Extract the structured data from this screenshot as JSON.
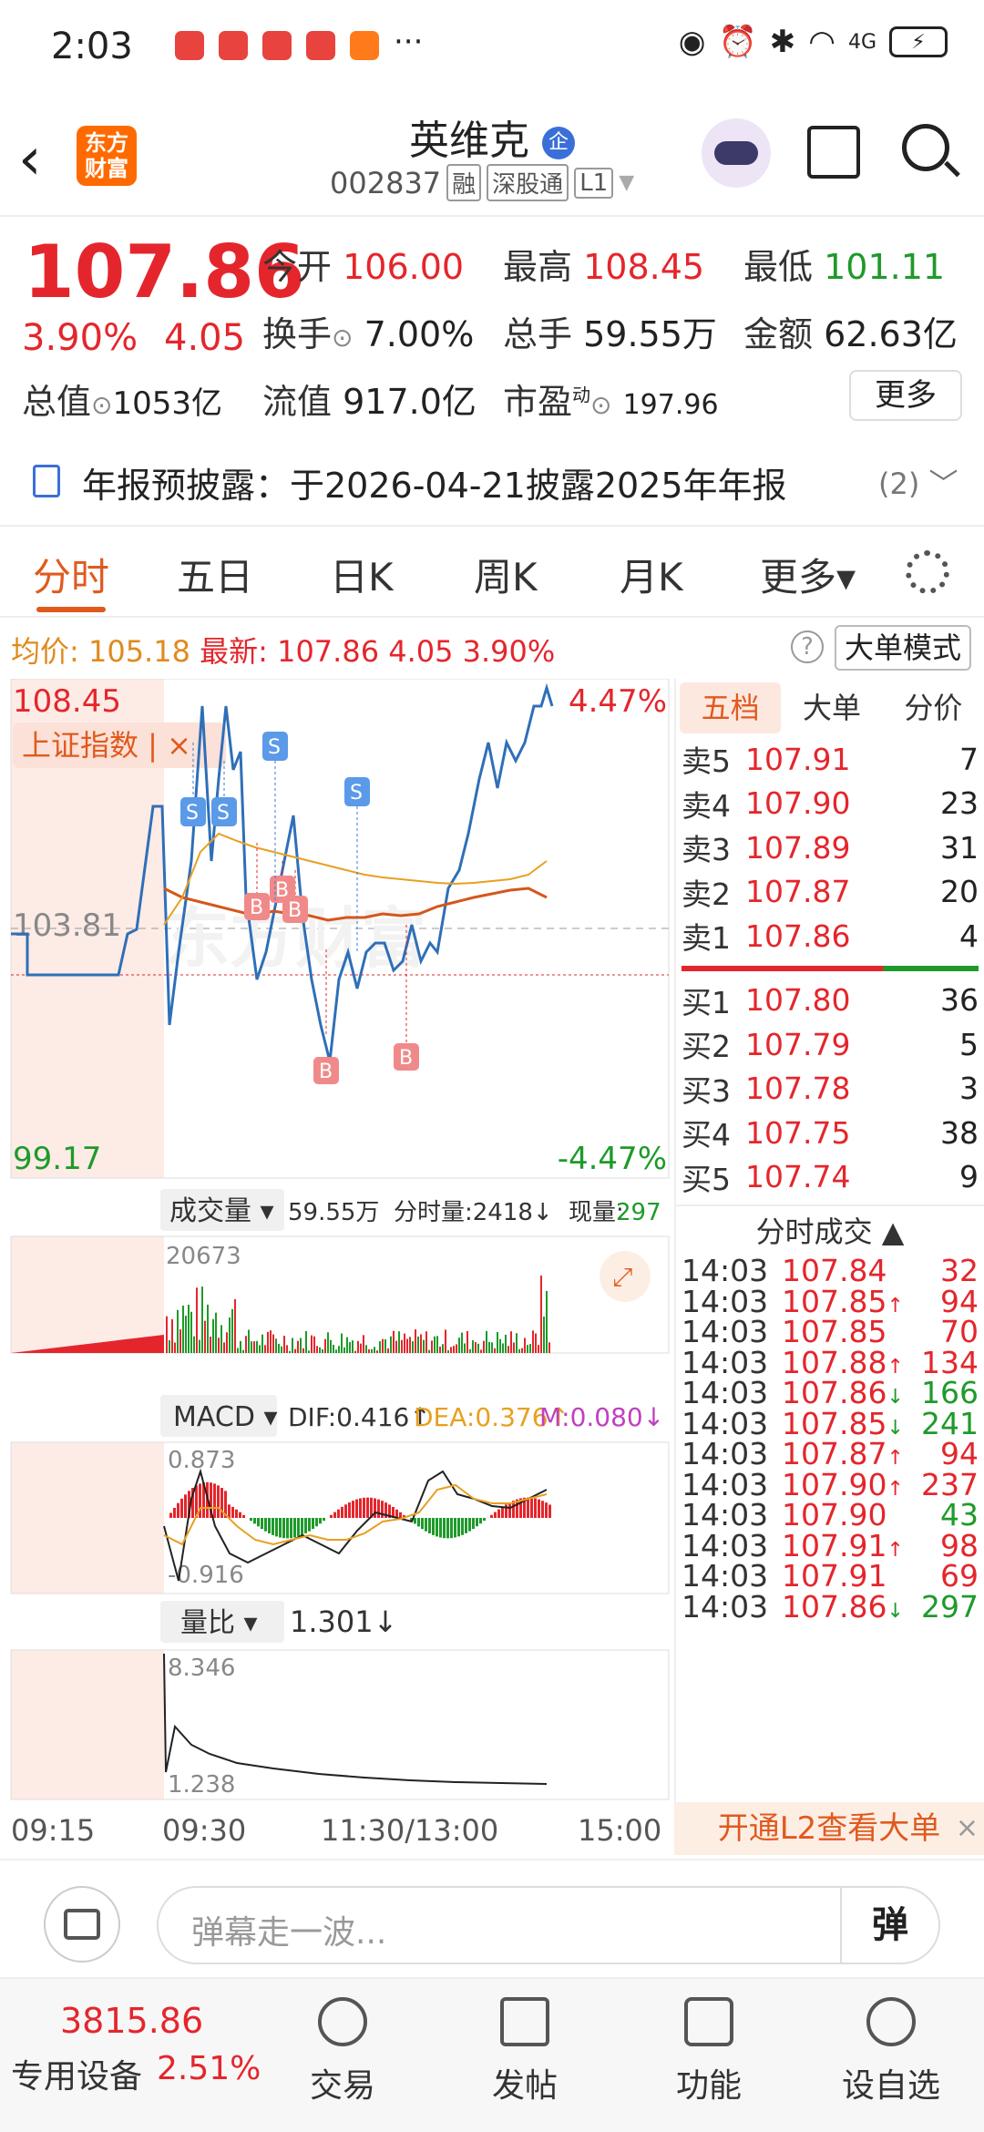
{
  "status": {
    "time": "2:03",
    "dots": "···",
    "network": "4G",
    "battery": "⚡"
  },
  "header": {
    "stock_name": "英维克",
    "qi_badge": "企",
    "code": "002837",
    "tags": [
      "融",
      "深股通",
      "L1"
    ],
    "logo_text_1": "东方",
    "logo_text_2": "财富"
  },
  "quote": {
    "price": "107.86",
    "pct": "3.90%",
    "change": "4.05",
    "open_l": "今开",
    "open": "106.00",
    "high_l": "最高",
    "high": "108.45",
    "low_l": "最低",
    "low": "101.11",
    "turnover_l": "换手",
    "turnover": "7.00%",
    "vol_l": "总手",
    "vol": "59.55万",
    "amt_l": "金额",
    "amt": "62.63亿",
    "mcap_l": "总值",
    "mcap": "1053亿",
    "float_l": "流值",
    "float": "917.0亿",
    "pe_l": "市盈",
    "pe_sup": "动",
    "pe": "197.96",
    "more": "更多"
  },
  "notice": {
    "text": "年报预披露：于2026-04-21披露2025年年报",
    "count": "(2)"
  },
  "tabs": [
    "分时",
    "五日",
    "日K",
    "周K",
    "月K",
    "更多▾"
  ],
  "avg": {
    "label": "均价:",
    "value": "105.18",
    "latest_label": "最新:",
    "latest": "107.86",
    "chg": "4.05",
    "pct": "3.90%",
    "help": "?",
    "mode": "大单模式"
  },
  "chart": {
    "top_price": "108.45",
    "top_pct": "4.47%",
    "ref": "103.81",
    "bot_price": "99.17",
    "bot_pct": "-4.47%",
    "index_tag": "上证指数 | ×",
    "vol_header": "成交量 ▾",
    "vol_total": "59.55万",
    "vol_fen": "分时量:2418↓",
    "vol_now_l": "现量:",
    "vol_now": "297",
    "vol_max": "20673",
    "macd_header": "MACD ▾",
    "dif": "DIF:0.416↑",
    "dea": "DEA:0.376↑",
    "m": "M:0.080↓",
    "macd_top": "0.873",
    "macd_bot": "-0.916",
    "lb_header": "量比 ▾",
    "lb_val": "1.301↓",
    "lb_top": "8.346",
    "lb_bot": "1.238",
    "times": [
      "09:15",
      "09:30",
      "11:30/13:00",
      "15:00"
    ],
    "watermark": "东方财富",
    "buy_marks": [
      "B",
      "B",
      "B",
      "B",
      "B"
    ],
    "sell_marks": [
      "S",
      "S",
      "S",
      "S"
    ]
  },
  "orderbook": {
    "tabs": [
      "五档",
      "大单",
      "分价"
    ],
    "asks": [
      {
        "k": "卖5",
        "p": "107.91",
        "q": "7"
      },
      {
        "k": "卖4",
        "p": "107.90",
        "q": "23"
      },
      {
        "k": "卖3",
        "p": "107.89",
        "q": "31"
      },
      {
        "k": "卖2",
        "p": "107.87",
        "q": "20"
      },
      {
        "k": "卖1",
        "p": "107.86",
        "q": "4"
      }
    ],
    "bids": [
      {
        "k": "买1",
        "p": "107.80",
        "q": "36"
      },
      {
        "k": "买2",
        "p": "107.79",
        "q": "5"
      },
      {
        "k": "买3",
        "p": "107.78",
        "q": "3"
      },
      {
        "k": "买4",
        "p": "107.75",
        "q": "38"
      },
      {
        "k": "买5",
        "p": "107.74",
        "q": "9"
      }
    ],
    "trades_header": "分时成交 ▲",
    "trades": [
      {
        "t": "14:03",
        "p": "107.84",
        "a": "",
        "q": "32",
        "c": "red"
      },
      {
        "t": "14:03",
        "p": "107.85",
        "a": "↑",
        "q": "94",
        "c": "red"
      },
      {
        "t": "14:03",
        "p": "107.85",
        "a": "",
        "q": "70",
        "c": "red"
      },
      {
        "t": "14:03",
        "p": "107.88",
        "a": "↑",
        "q": "134",
        "c": "red"
      },
      {
        "t": "14:03",
        "p": "107.86",
        "a": "↓",
        "q": "166",
        "c": "green"
      },
      {
        "t": "14:03",
        "p": "107.85",
        "a": "↓",
        "q": "241",
        "c": "green"
      },
      {
        "t": "14:03",
        "p": "107.87",
        "a": "↑",
        "q": "94",
        "c": "red"
      },
      {
        "t": "14:03",
        "p": "107.90",
        "a": "↑",
        "q": "237",
        "c": "red"
      },
      {
        "t": "14:03",
        "p": "107.90",
        "a": "",
        "q": "43",
        "c": "green"
      },
      {
        "t": "14:03",
        "p": "107.91",
        "a": "↑",
        "q": "98",
        "c": "red"
      },
      {
        "t": "14:03",
        "p": "107.91",
        "a": "",
        "q": "69",
        "c": "red"
      },
      {
        "t": "14:03",
        "p": "107.86",
        "a": "↓",
        "q": "297",
        "c": "green"
      }
    ],
    "l2": "开通L2查看大单",
    "l2_close": "×"
  },
  "danmu": {
    "placeholder": "弹幕走一波...",
    "switch": "弹"
  },
  "nav": {
    "index_val": "3815.86",
    "index_label": "专用设备",
    "index_pct": "2.51%",
    "items": [
      "交易",
      "发帖",
      "功能",
      "设自选"
    ]
  }
}
